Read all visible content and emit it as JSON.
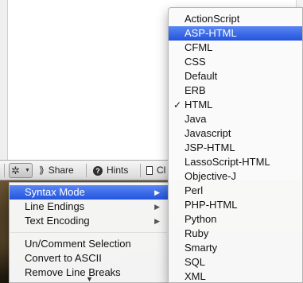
{
  "toolbar": {
    "gear_icon": "gear-icon",
    "share_label": "Share",
    "hints_label": "Hints",
    "clipped_label": "Cl"
  },
  "gear_menu": {
    "items": [
      {
        "label": "Syntax Mode",
        "submenu": true,
        "active": true
      },
      {
        "label": "Line Endings",
        "submenu": true
      },
      {
        "label": "Text Encoding",
        "submenu": true
      },
      {
        "label": "Un/Comment Selection"
      },
      {
        "label": "Convert to ASCII"
      },
      {
        "label": "Remove Line Breaks"
      }
    ],
    "scroll_indicator": "▼"
  },
  "syntax_menu": {
    "items": [
      {
        "label": "ActionScript"
      },
      {
        "label": "ASP-HTML",
        "highlighted": true
      },
      {
        "label": "CFML"
      },
      {
        "label": "CSS"
      },
      {
        "label": "Default"
      },
      {
        "label": "ERB"
      },
      {
        "label": "HTML",
        "checked": true,
        "check_glyph": "✓"
      },
      {
        "label": "Java"
      },
      {
        "label": "Javascript"
      },
      {
        "label": "JSP-HTML"
      },
      {
        "label": "LassoScript-HTML"
      },
      {
        "label": "Objective-J"
      },
      {
        "label": "Perl"
      },
      {
        "label": "PHP-HTML"
      },
      {
        "label": "Python"
      },
      {
        "label": "Ruby"
      },
      {
        "label": "Smarty"
      },
      {
        "label": "SQL"
      },
      {
        "label": "XML"
      }
    ]
  },
  "colors": {
    "highlight": "#2f62e6",
    "menu_background": "#f8f8f8"
  }
}
